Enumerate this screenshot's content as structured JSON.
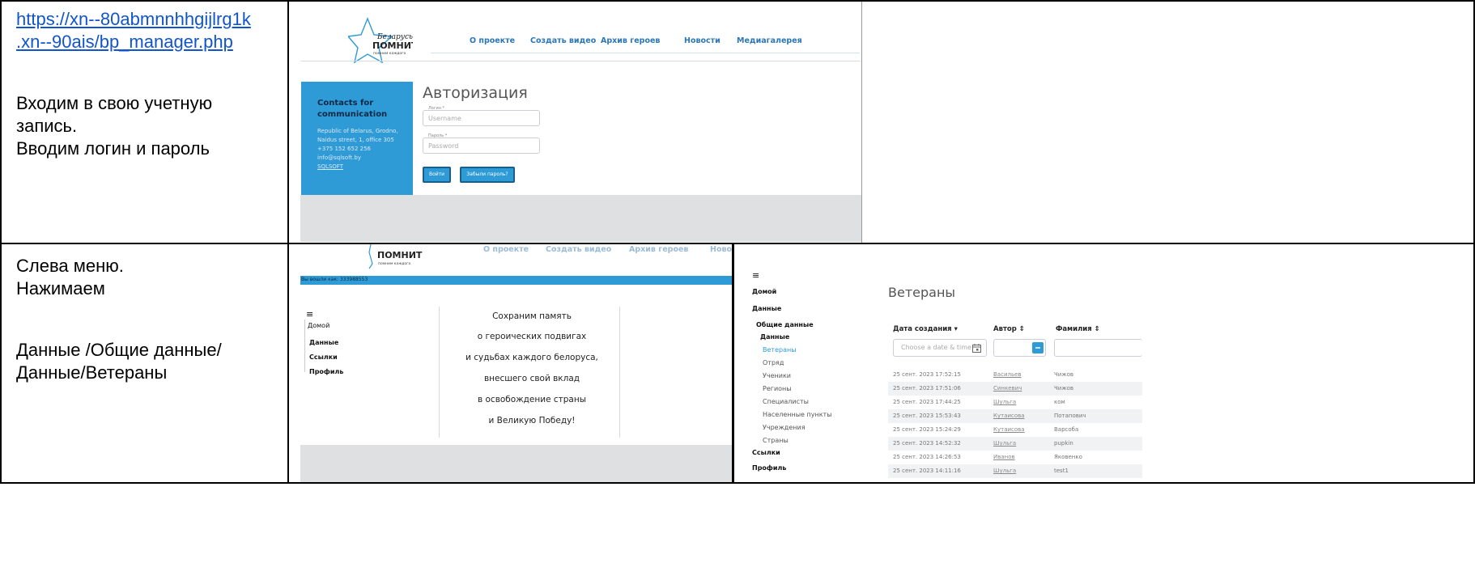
{
  "step1": {
    "link": "https://xn--80abmnnhhgijlrg1k.xn--90ais/bp_manager.php",
    "link_line1": "https://xn--80abmnnhhgijlrg1k",
    "link_line2": ".xn--90ais/bp_manager.php",
    "text_line1": "Входим в свою учетную",
    "text_line2": "запись.",
    "text_line3": "Вводим логин и пароль"
  },
  "step2": {
    "text_line1": "Слева меню.",
    "text_line2": "Нажимаем",
    "text_line3": "Данные /Общие данные/",
    "text_line4": "Данные/Ветераны"
  },
  "screen1": {
    "logo_line1": "Беларусь",
    "logo_line2": "ПОМНИТ",
    "logo_line3": "помним каждого",
    "nav": [
      "О проекте",
      "Создать видео",
      "Архив героев",
      "Новости",
      "Медиагалерея"
    ],
    "contacts_title": "Contacts for communication",
    "contacts_lines": [
      "Republic of Belarus, Grodno,",
      "Naidus street, 1, office 305",
      "+375 152 652 256",
      "info@sqlsoft.by",
      "SQLSOFT"
    ],
    "auth_title": "Авторизация",
    "login_label": "Логин *",
    "login_placeholder": "Username",
    "password_label": "Пароль *",
    "password_placeholder": "Password",
    "login_button": "Войти",
    "forgot_button": "Забыли пароль?"
  },
  "screen2": {
    "logo_line2": "ПОМНИТ",
    "logo_line3": "помним каждого",
    "nav_cut": [
      "О проекте",
      "Создать видео",
      "Архив героев",
      "Ново"
    ],
    "logged_in": "Вы вошли как: 333988553",
    "menu_icon": "≡",
    "menu": [
      "Домой",
      "Данные",
      "Ссылки",
      "Профиль"
    ],
    "quote": [
      "Сохраним память",
      "о героических подвигах",
      "и судьбах каждого белоруса,",
      "внесшего свой вклад",
      "в освобождение страны",
      "и Великую Победу!"
    ]
  },
  "screen3": {
    "menu_icon": "≡",
    "menu_home": "Домой",
    "menu_data": "Данные",
    "menu_common": "Общие данные",
    "menu_data_sub": "Данные",
    "submenu": [
      "Ветераны",
      "Отряд",
      "Ученики",
      "Регионы",
      "Специалисты",
      "Населенные пункты",
      "Учреждения",
      "Страны"
    ],
    "menu_links": "Ссылки",
    "menu_profile": "Профиль",
    "title": "Ветераны",
    "col_date": "Дата создания ▾",
    "col_author": "Автор ⇕",
    "col_surname": "Фамилия ⇕",
    "date_placeholder": "Choose a date & time",
    "rows": [
      {
        "date": "25 сент. 2023 17:52:15",
        "author": "Васильев",
        "surname": "Чижов"
      },
      {
        "date": "25 сент. 2023 17:51:06",
        "author": "Синкевич",
        "surname": "Чижов"
      },
      {
        "date": "25 сент. 2023 17:44:25",
        "author": "Шульга",
        "surname": "ком"
      },
      {
        "date": "25 сент. 2023 15:53:43",
        "author": "Кутаисова",
        "surname": "Потапович"
      },
      {
        "date": "25 сент. 2023 15:24:29",
        "author": "Кутаисова",
        "surname": "Варсоба"
      },
      {
        "date": "25 сент. 2023 14:52:32",
        "author": "Шульга",
        "surname": "pupkin"
      },
      {
        "date": "25 сент. 2023 14:26:53",
        "author": "Иванов",
        "surname": "Яковенко"
      },
      {
        "date": "25 сент. 2023 14:11:16",
        "author": "Шульга",
        "surname": "test1"
      }
    ]
  },
  "colors": {
    "accent_blue": "#2e9ad6",
    "link_blue": "#1155cc",
    "footer_gray": "#dfe0e2"
  }
}
